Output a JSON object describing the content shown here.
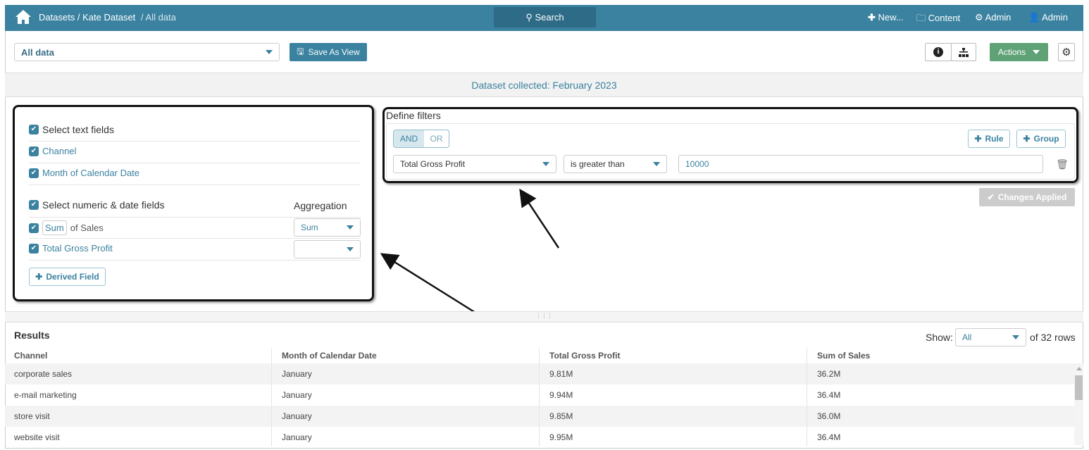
{
  "header": {
    "breadcrumb_datasets": "Datasets / Kate Dataset",
    "breadcrumb_current": "/ All data",
    "search_label": "Search",
    "new_label": "New...",
    "content_label": "Content",
    "admin_settings_label": "Admin",
    "user_label": "Admin"
  },
  "toolbar": {
    "view_select": "All data",
    "save_as_view": "Save As View",
    "actions": "Actions"
  },
  "banner": "Dataset collected: February 2023",
  "fields": {
    "select_text": "Select text fields",
    "text_fields": [
      "Channel",
      "Month of Calendar Date"
    ],
    "select_numeric": "Select numeric & date fields",
    "aggregation_header": "Aggregation",
    "sum_tag": "Sum",
    "of_sales": "of Sales",
    "total_gross_profit": "Total Gross Profit",
    "sales_aggregation": "Sum",
    "tgp_aggregation": "",
    "derived_field": "Derived Field"
  },
  "filters": {
    "title": "Define filters",
    "and": "AND",
    "or": "OR",
    "rule": "Rule",
    "group": "Group",
    "field": "Total Gross Profit",
    "operator": "is greater than",
    "value": "10000",
    "changes_applied": "Changes Applied"
  },
  "results": {
    "title": "Results",
    "show_label": "Show:",
    "show_value": "All",
    "rows_count": "of 32 rows",
    "columns": [
      "Channel",
      "Month of Calendar Date",
      "Total Gross Profit",
      "Sum of Sales"
    ],
    "rows": [
      [
        "corporate sales",
        "January",
        "9.81M",
        "36.2M"
      ],
      [
        "e-mail marketing",
        "January",
        "9.94M",
        "36.4M"
      ],
      [
        "store visit",
        "January",
        "9.85M",
        "36.0M"
      ],
      [
        "website visit",
        "January",
        "9.95M",
        "36.4M"
      ]
    ]
  }
}
